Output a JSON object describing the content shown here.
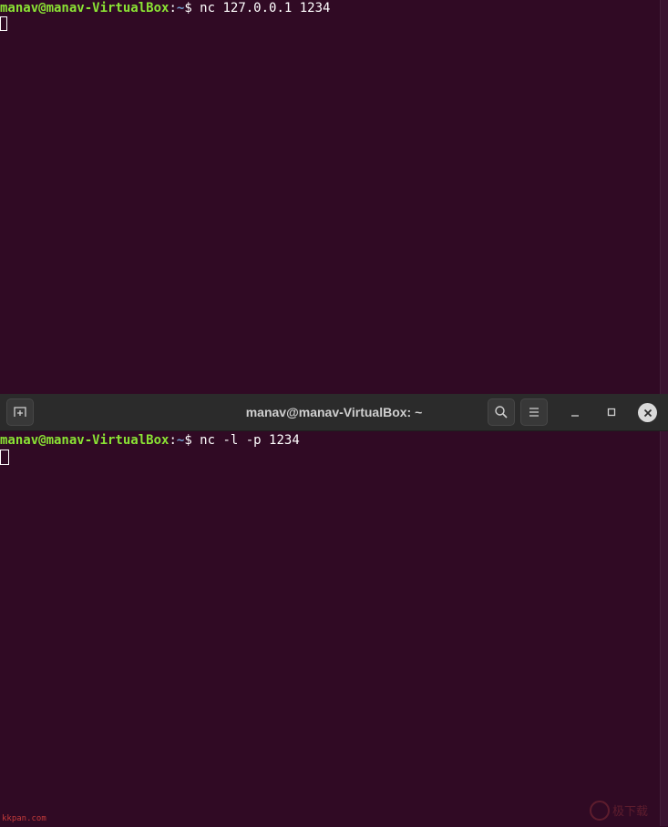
{
  "top_terminal": {
    "prompt_user_host": "manav@manav-VirtualBox",
    "prompt_sep": ":",
    "prompt_path": "~",
    "prompt_dollar": "$ ",
    "command": "nc 127.0.0.1 1234"
  },
  "window": {
    "title": "manav@manav-VirtualBox: ~",
    "new_tab_icon": "new-tab-icon",
    "search_icon": "search-icon",
    "menu_icon": "hamburger-menu-icon",
    "minimize_icon": "minimize-icon",
    "maximize_icon": "maximize-icon",
    "close_icon": "close-icon"
  },
  "bottom_terminal": {
    "prompt_user_host": "manav@manav-VirtualBox",
    "prompt_sep": ":",
    "prompt_path": "~",
    "prompt_dollar": "$ ",
    "command": "nc -l -p 1234"
  },
  "watermark": {
    "left_text": "kkpan.com",
    "right_logo_text": "极下载"
  },
  "colors": {
    "background": "#300a24",
    "prompt_user": "#8ae234",
    "prompt_path": "#729fcf",
    "titlebar": "#2b2b2b"
  }
}
